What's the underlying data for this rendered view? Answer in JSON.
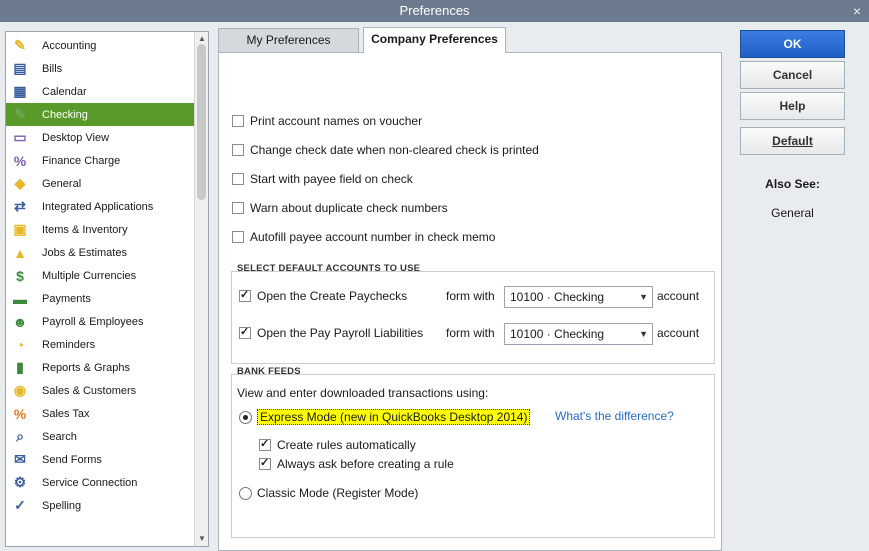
{
  "window": {
    "title": "Preferences",
    "close_glyph": "×"
  },
  "sidebar": {
    "items": [
      {
        "label": "Accounting",
        "icon": "accounting-icon"
      },
      {
        "label": "Bills",
        "icon": "bills-icon"
      },
      {
        "label": "Calendar",
        "icon": "calendar-icon"
      },
      {
        "label": "Checking",
        "icon": "checking-icon",
        "selected": true
      },
      {
        "label": "Desktop View",
        "icon": "desktop-view-icon"
      },
      {
        "label": "Finance Charge",
        "icon": "finance-charge-icon"
      },
      {
        "label": "General",
        "icon": "general-icon"
      },
      {
        "label": "Integrated Applications",
        "icon": "integrated-applications-icon"
      },
      {
        "label": "Items & Inventory",
        "icon": "items-inventory-icon"
      },
      {
        "label": "Jobs & Estimates",
        "icon": "jobs-estimates-icon"
      },
      {
        "label": "Multiple Currencies",
        "icon": "multiple-currencies-icon"
      },
      {
        "label": "Payments",
        "icon": "payments-icon"
      },
      {
        "label": "Payroll & Employees",
        "icon": "payroll-employees-icon"
      },
      {
        "label": "Reminders",
        "icon": "reminders-icon"
      },
      {
        "label": "Reports & Graphs",
        "icon": "reports-graphs-icon"
      },
      {
        "label": "Sales & Customers",
        "icon": "sales-customers-icon"
      },
      {
        "label": "Sales Tax",
        "icon": "sales-tax-icon"
      },
      {
        "label": "Search",
        "icon": "search-icon"
      },
      {
        "label": "Send Forms",
        "icon": "send-forms-icon"
      },
      {
        "label": "Service Connection",
        "icon": "service-connection-icon"
      },
      {
        "label": "Spelling",
        "icon": "spelling-icon"
      }
    ]
  },
  "tabs": {
    "my_preferences": "My Preferences",
    "company_preferences": "Company Preferences",
    "active": "company_preferences"
  },
  "options": [
    {
      "label": "Print account names on voucher",
      "checked": false
    },
    {
      "label": "Change check date when non-cleared check is printed",
      "checked": false
    },
    {
      "label": "Start with payee field on check",
      "checked": false
    },
    {
      "label": "Warn about duplicate check numbers",
      "checked": false
    },
    {
      "label": "Autofill payee account number in check memo",
      "checked": false
    }
  ],
  "default_accounts": {
    "heading": "SELECT DEFAULT ACCOUNTS TO USE",
    "rows": [
      {
        "label": "Open the Create Paychecks",
        "checked": true,
        "form_with": "form with",
        "account_value": "10100 · Checking",
        "suffix": "account"
      },
      {
        "label": "Open the Pay Payroll Liabilities",
        "checked": true,
        "form_with": "form with",
        "account_value": "10100 · Checking",
        "suffix": "account"
      }
    ]
  },
  "bank_feeds": {
    "heading": "BANK FEEDS",
    "intro": "View and enter downloaded transactions using:",
    "express_mode": {
      "label": "Express Mode (new in QuickBooks Desktop 2014)",
      "selected": true
    },
    "difference_link": "What's the difference?",
    "sub_options": [
      {
        "label": "Create rules automatically",
        "checked": true
      },
      {
        "label": "Always ask before creating a rule",
        "checked": true
      }
    ],
    "classic_mode": {
      "label": "Classic Mode (Register Mode)",
      "selected": false
    }
  },
  "buttons": {
    "ok": "OK",
    "cancel": "Cancel",
    "help": "Help",
    "default": "Default"
  },
  "also_see": {
    "heading": "Also See:",
    "link": "General"
  }
}
